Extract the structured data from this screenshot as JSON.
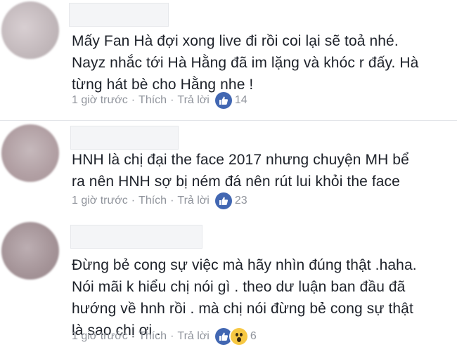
{
  "comments": [
    {
      "lines": [
        "Mấy Fan Hà đợi xong live đi rồi coi lại sẽ toả nhé.",
        "Nayz nhắc tới Hà Hằng đã im lặng và khóc r đấy. Hà",
        "từng hát bè cho Hằng nhe !"
      ],
      "time": "1 giờ trước",
      "like_label": "Thích",
      "reply_label": "Trả lời",
      "reactions": [
        "like"
      ],
      "reaction_count": "14"
    },
    {
      "lines": [
        "HNH là chị đại the face 2017 nhưng chuyện MH bể",
        "ra nên HNH sợ bị ném đá nên rút lui khỏi the face"
      ],
      "time": "1 giờ trước",
      "like_label": "Thích",
      "reply_label": "Trả lời",
      "reactions": [
        "like"
      ],
      "reaction_count": "23"
    },
    {
      "lines": [
        "Đừng bẻ cong sự việc mà hãy nhìn đúng thật .haha.",
        "Nói mãi k hiểu chị nói gì . theo dư luận ban đầu đã",
        "hướng về hnh rồi . mà chị nói đừng bẻ cong sự thật",
        "là sao chị ơi ."
      ],
      "time": "1 giờ trước",
      "like_label": "Thích",
      "reply_label": "Trả lời",
      "reactions": [
        "like",
        "wow"
      ],
      "reaction_count": "6"
    }
  ],
  "colors": {
    "text": "#1d2129",
    "meta": "#90949c",
    "like_blue": "#4267b2",
    "wow_yellow": "#f7c843"
  },
  "icons": [
    "like-reaction-icon",
    "wow-reaction-icon"
  ]
}
